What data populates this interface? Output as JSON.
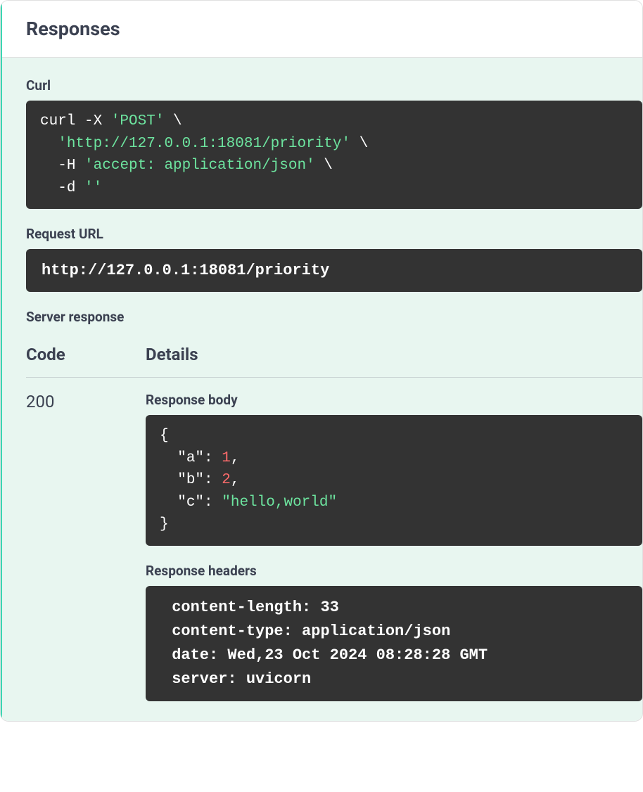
{
  "header": {
    "title": "Responses"
  },
  "curl": {
    "label": "Curl",
    "tokens": [
      {
        "t": "curl -X ",
        "c": "w"
      },
      {
        "t": "'POST'",
        "c": "g"
      },
      {
        "t": " \\\n  ",
        "c": "w"
      },
      {
        "t": "'http://127.0.0.1:18081/priority'",
        "c": "g"
      },
      {
        "t": " \\\n  -H ",
        "c": "w"
      },
      {
        "t": "'accept: application/json'",
        "c": "g"
      },
      {
        "t": " \\\n  -d ",
        "c": "w"
      },
      {
        "t": "''",
        "c": "g"
      }
    ]
  },
  "request_url": {
    "label": "Request URL",
    "value": "http://127.0.0.1:18081/priority"
  },
  "server_response": {
    "label": "Server response",
    "code_label": "Code",
    "details_label": "Details",
    "status_code": "200",
    "body_label": "Response body",
    "body_tokens": [
      {
        "t": "{\n  ",
        "c": "w"
      },
      {
        "t": "\"a\"",
        "c": "w"
      },
      {
        "t": ": ",
        "c": "w"
      },
      {
        "t": "1",
        "c": "r"
      },
      {
        "t": ",\n  ",
        "c": "w"
      },
      {
        "t": "\"b\"",
        "c": "w"
      },
      {
        "t": ": ",
        "c": "w"
      },
      {
        "t": "2",
        "c": "r"
      },
      {
        "t": ",\n  ",
        "c": "w"
      },
      {
        "t": "\"c\"",
        "c": "w"
      },
      {
        "t": ": ",
        "c": "w"
      },
      {
        "t": "\"hello,world\"",
        "c": "g"
      },
      {
        "t": "\n}",
        "c": "w"
      }
    ],
    "headers_label": "Response headers",
    "headers": " content-length: 33 \n content-type: application/json \n date: Wed,23 Oct 2024 08:28:28 GMT \n server: uvicorn "
  }
}
